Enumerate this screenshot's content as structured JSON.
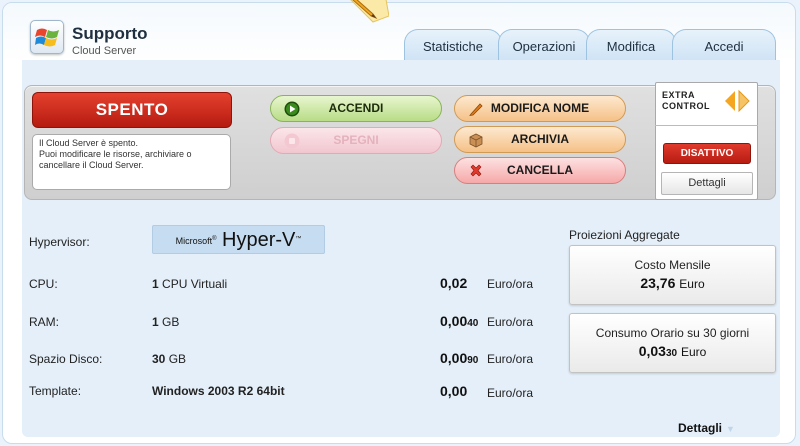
{
  "header": {
    "title": "Supporto",
    "subtitle": "Cloud Server"
  },
  "tabs": [
    {
      "label": "Statistiche"
    },
    {
      "label": "Operazioni"
    },
    {
      "label": "Modifica"
    },
    {
      "label": "Accedi"
    }
  ],
  "status": {
    "label": "SPENTO",
    "description_lines": [
      "Il Cloud Server è spento.",
      "Puoi modificare le risorse, archiviare o",
      "cancellare il Cloud Server."
    ]
  },
  "actions": {
    "accendi": "ACCENDI",
    "spegni": "SPEGNI",
    "modifica_nome": "MODIFICA NOME",
    "archivia": "ARCHIVIA",
    "cancella": "CANCELLA"
  },
  "extra_control": {
    "logo_line1": "EXTRA",
    "logo_line2": "CONTROL",
    "toggle_label": "DISATTIVO",
    "details_label": "Dettagli"
  },
  "specs": {
    "hypervisor_label": "Hypervisor:",
    "hypervisor_brand": "Microsoft",
    "hypervisor_name": "Hyper-V",
    "rows": [
      {
        "label": "CPU:",
        "amount": "1",
        "unit_text": "CPU Virtuali",
        "price_main": "0,02",
        "price_small": "",
        "price_unit": "Euro/ora"
      },
      {
        "label": "RAM:",
        "amount": "1",
        "unit_text": "GB",
        "price_main": "0,00",
        "price_small": "40",
        "price_unit": "Euro/ora"
      },
      {
        "label": "Spazio Disco:",
        "amount": "30",
        "unit_text": "GB",
        "price_main": "0,00",
        "price_small": "90",
        "price_unit": "Euro/ora"
      },
      {
        "label": "Template:",
        "amount": "Windows 2003 R2 64bit",
        "unit_text": "",
        "price_main": "0,00",
        "price_small": "",
        "price_unit": "Euro/ora"
      }
    ]
  },
  "projections": {
    "title": "Proiezioni Aggregate",
    "monthly_label": "Costo Mensile",
    "monthly_value": "23,76",
    "monthly_unit": "Euro",
    "hourly_label": "Consumo Orario su 30 giorni",
    "hourly_value_main": "0,03",
    "hourly_value_small": "30",
    "hourly_unit": "Euro"
  },
  "footer": {
    "details_label": "Dettagli"
  },
  "colors": {
    "status_red": "#c9271b",
    "accent_green": "#b8dd86",
    "accent_orange": "#f5c187",
    "accent_pink": "#f6a8a8",
    "content_blue": "#e4eff9"
  }
}
